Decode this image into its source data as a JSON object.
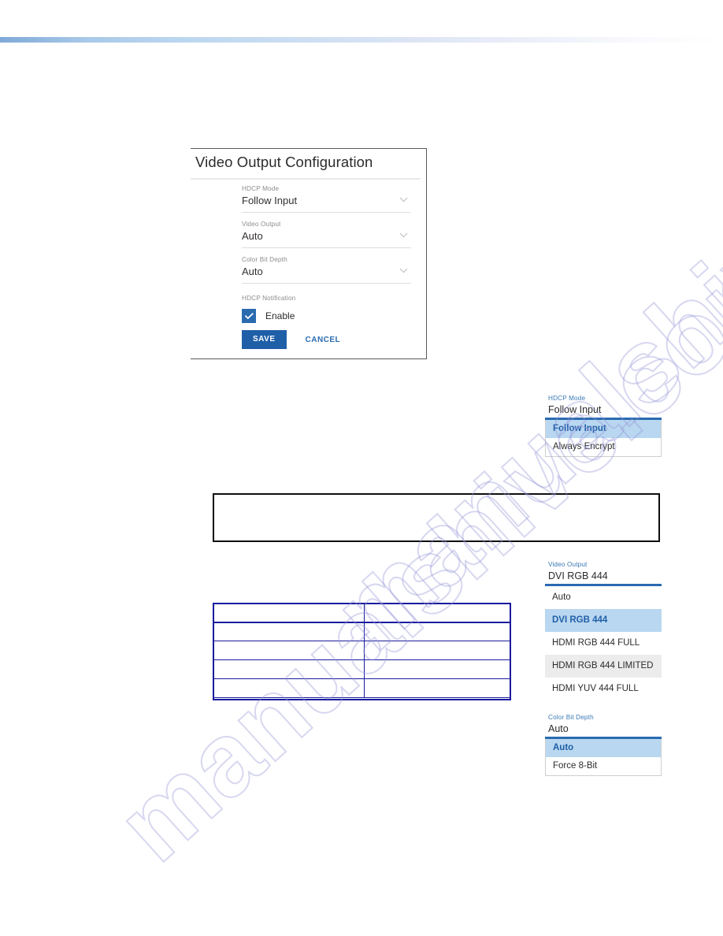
{
  "page": {
    "watermark": "manualshive.com"
  },
  "card": {
    "title": "Video Output Configuration",
    "fields": [
      {
        "label": "HDCP Mode",
        "value": "Follow Input",
        "icon": "chevron-down-icon"
      },
      {
        "label": "Video Output",
        "value": "Auto",
        "icon": "chevron-down-icon"
      },
      {
        "label": "Color Bit Depth",
        "value": "Auto",
        "icon": "chevron-down-icon"
      }
    ],
    "notification": {
      "label": "HDCP Notification",
      "checkbox_label": "Enable",
      "checked": true,
      "check_icon": "checkmark-icon"
    },
    "buttons": {
      "save": "SAVE",
      "cancel": "CANCEL"
    }
  },
  "dropdowns": [
    {
      "name": "hdcp-mode",
      "label": "HDCP Mode",
      "value": "Follow Input",
      "options": [
        {
          "text": "Follow Input",
          "state": "selected"
        },
        {
          "text": "Always Encrypt",
          "state": "normal"
        }
      ]
    },
    {
      "name": "video-output",
      "label": "Video Output",
      "value": "DVI RGB 444",
      "options": [
        {
          "text": "Auto",
          "state": "normal"
        },
        {
          "text": "DVI RGB 444",
          "state": "selected"
        },
        {
          "text": "HDMI RGB 444 FULL",
          "state": "normal"
        },
        {
          "text": "HDMI RGB 444 LIMITED",
          "state": "hover"
        },
        {
          "text": "HDMI YUV 444 FULL",
          "state": "normal"
        }
      ]
    },
    {
      "name": "color-bit-depth",
      "label": "Color Bit Depth",
      "value": "Auto",
      "options": [
        {
          "text": "Auto",
          "state": "selected"
        },
        {
          "text": "Force 8-Bit",
          "state": "normal"
        }
      ]
    }
  ],
  "note_box": {
    "text": ""
  },
  "table": {
    "rows": [
      [
        "",
        ""
      ],
      [
        "",
        ""
      ],
      [
        "",
        ""
      ],
      [
        "",
        ""
      ],
      [
        "",
        ""
      ]
    ]
  },
  "colors": {
    "accent_blue": "#2a6bb0",
    "save_blue": "#1f5fa8",
    "selected_row": "#b9d7f0",
    "hover_row": "#ececec",
    "table_border": "#1a1a9e",
    "watermark": "#9696d7"
  }
}
